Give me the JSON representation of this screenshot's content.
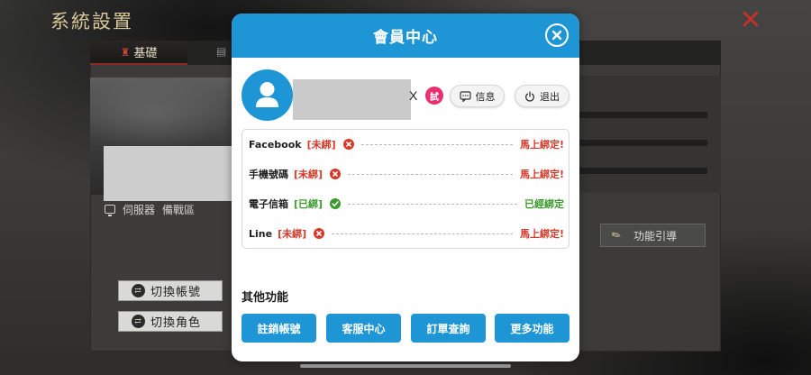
{
  "background": {
    "title": "系統設置",
    "tabs": [
      {
        "label": "基礎",
        "icon": "tower-icon"
      },
      {
        "label": "",
        "icon": "tab-icon"
      }
    ],
    "server_label": "伺服器",
    "server_name": "備戰區",
    "switch_account_label": "切換帳號",
    "switch_role_label": "切換角色",
    "guide_label": "功能引導",
    "close_icon": "close-icon",
    "accent_red": "#c0332b"
  },
  "modal": {
    "title": "會員中心",
    "user": {
      "name_suffix": "X",
      "trial_badge": "試"
    },
    "info_button": "信息",
    "logout_button": "退出",
    "bindings": [
      {
        "name": "Facebook",
        "status": "[未綁]",
        "bound": false,
        "action": "馬上綁定!"
      },
      {
        "name": "手機號碼",
        "status": "[未綁]",
        "bound": false,
        "action": "馬上綁定!"
      },
      {
        "name": "電子信箱",
        "status": "[已綁]",
        "bound": true,
        "action": "已經綁定"
      },
      {
        "name": "Line",
        "status": "[未綁]",
        "bound": false,
        "action": "馬上綁定!"
      }
    ],
    "other_title": "其他功能",
    "functions": [
      "註銷帳號",
      "客服中心",
      "訂單查詢",
      "更多功能"
    ],
    "colors": {
      "header": "#1e95d5",
      "unbound": "#d23a2b",
      "bound": "#3b9a2c",
      "trial_badge": "#e8306e"
    }
  }
}
